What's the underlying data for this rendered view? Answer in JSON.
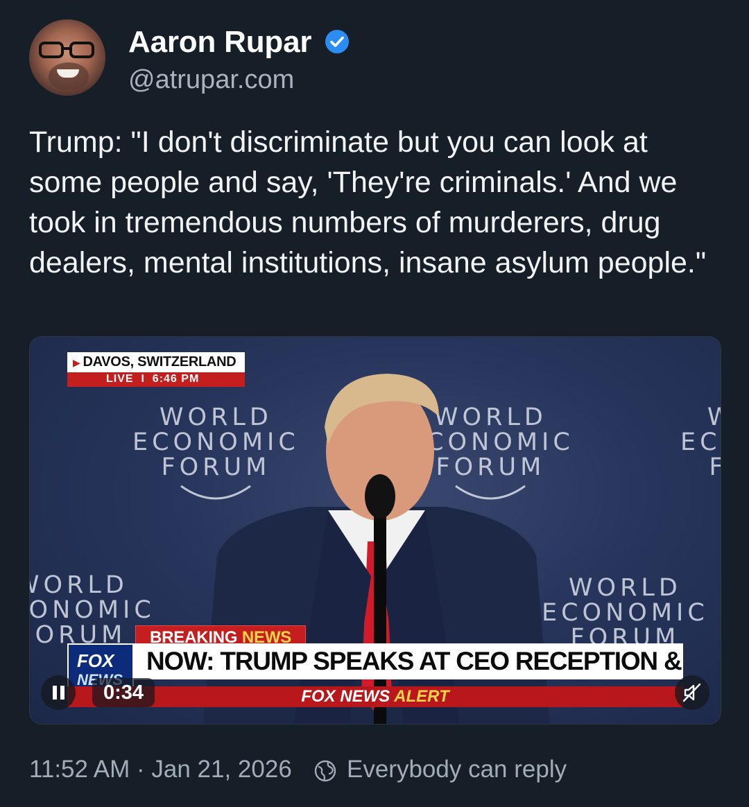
{
  "author": {
    "name": "Aaron Rupar",
    "handle": "@atrupar.com",
    "verified": true,
    "accent_color": "#2b8cf3"
  },
  "post": {
    "text": "Trump: \"I don't discriminate but you can look at some people and say, 'They're criminals.' And we took in tremendous numbers of murderers, drug dealers, mental institutions, insane asylum people.\""
  },
  "video": {
    "location": "DAVOS, SWITZERLAND",
    "live_label": "LIVE",
    "live_time": "6:46 PM",
    "backdrop_text": [
      "WORLD",
      "ECONOMIC",
      "FORUM"
    ],
    "breaking_label": "BREAKING",
    "breaking_news": "NEWS",
    "channel_logo": "FOX",
    "channel_logo_sub": "NEWS",
    "headline": "NOW: TRUMP SPEAKS AT CEO RECEPTION & DINNER",
    "alert_brand": "FOX NEWS",
    "alert_label": "ALERT",
    "elapsed": "0:34",
    "controls": {
      "pause_icon": "pause-icon",
      "mute_icon": "muted-speaker-icon"
    }
  },
  "footer": {
    "timestamp": "11:52 AM · Jan 21, 2026",
    "reply_setting_icon": "globe-icon",
    "reply_setting": "Everybody can reply"
  }
}
